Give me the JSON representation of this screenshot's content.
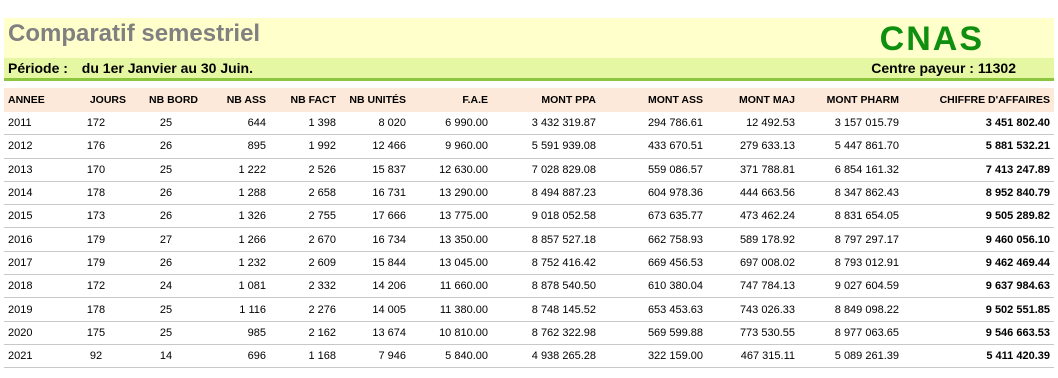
{
  "header": {
    "title": "Comparatif semestriel",
    "logo": "CNAS",
    "period_label": "Période :",
    "period_value": "du 1er Janvier au 30 Juin.",
    "payer": "Centre payeur : 11302"
  },
  "colors": {
    "header_bg": "#ffffcc",
    "period_bg": "#e6f7a4",
    "accent_green": "#8cc63f",
    "logo_green": "#0f8f0f",
    "title_gray": "#808080",
    "column_header_bg": "#fde9d9"
  },
  "table": {
    "columns": [
      "ANNEE",
      "JOURS",
      "NB BORD",
      "NB ASS",
      "NB FACT",
      "NB UNITÉS",
      "F.A.E",
      "MONT PPA",
      "MONT ASS",
      "MONT MAJ",
      "MONT PHARM",
      "CHIFFRE D'AFFAIRES"
    ],
    "rows": [
      [
        "2011",
        "172",
        "25",
        "644",
        "1 398",
        "8 020",
        "6 990.00",
        "3 432 319.87",
        "294 786.61",
        "12 492.53",
        "3 157 015.79",
        "3 451 802.40"
      ],
      [
        "2012",
        "176",
        "26",
        "895",
        "1 992",
        "12 466",
        "9 960.00",
        "5 591 939.08",
        "433 670.51",
        "279 633.13",
        "5 447 861.70",
        "5 881 532.21"
      ],
      [
        "2013",
        "170",
        "25",
        "1 222",
        "2 526",
        "15 837",
        "12 630.00",
        "7 028 829.08",
        "559 086.57",
        "371 788.81",
        "6 854 161.32",
        "7 413 247.89"
      ],
      [
        "2014",
        "178",
        "26",
        "1 288",
        "2 658",
        "16 731",
        "13 290.00",
        "8 494 887.23",
        "604 978.36",
        "444 663.56",
        "8 347 862.43",
        "8 952 840.79"
      ],
      [
        "2015",
        "173",
        "26",
        "1 326",
        "2 755",
        "17 666",
        "13 775.00",
        "9 018 052.58",
        "673 635.77",
        "473 462.24",
        "8 831 654.05",
        "9 505 289.82"
      ],
      [
        "2016",
        "179",
        "27",
        "1 266",
        "2 670",
        "16 734",
        "13 350.00",
        "8 857 527.18",
        "662 758.93",
        "589 178.92",
        "8 797 297.17",
        "9 460 056.10"
      ],
      [
        "2017",
        "179",
        "26",
        "1 232",
        "2 609",
        "15 844",
        "13 045.00",
        "8 752 416.42",
        "669 456.53",
        "697 008.02",
        "8 793 012.91",
        "9 462 469.44"
      ],
      [
        "2018",
        "172",
        "24",
        "1 081",
        "2 332",
        "14 206",
        "11 660.00",
        "8 878 540.50",
        "610 380.04",
        "747 784.13",
        "9 027 604.59",
        "9 637 984.63"
      ],
      [
        "2019",
        "178",
        "25",
        "1 116",
        "2 276",
        "14 005",
        "11 380.00",
        "8 748 145.52",
        "653 453.63",
        "743 026.33",
        "8 849 098.22",
        "9 502 551.85"
      ],
      [
        "2020",
        "175",
        "25",
        "985",
        "2 162",
        "13 674",
        "10 810.00",
        "8 762 322.98",
        "569 599.88",
        "773 530.55",
        "8 977 063.65",
        "9 546 663.53"
      ],
      [
        "2021",
        "92",
        "14",
        "696",
        "1 168",
        "7 946",
        "5 840.00",
        "4 938 265.28",
        "322 159.00",
        "467 315.11",
        "5 089 261.39",
        "5 411 420.39"
      ]
    ]
  }
}
